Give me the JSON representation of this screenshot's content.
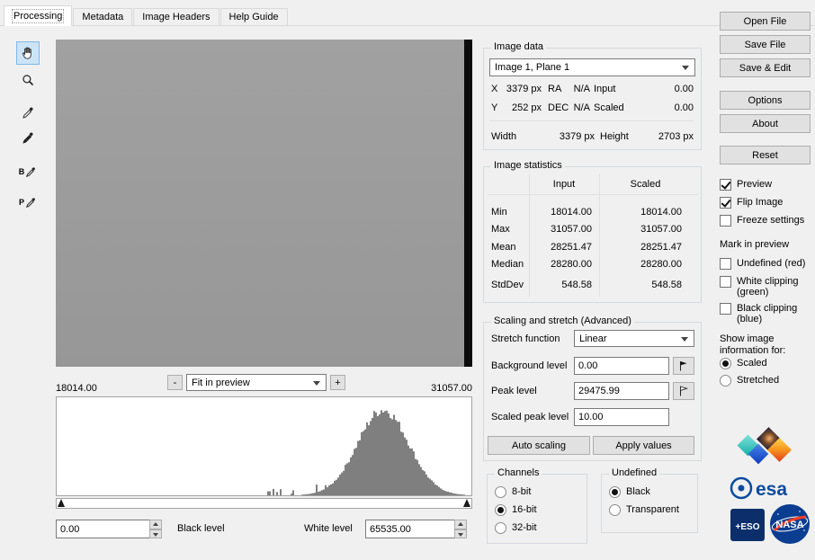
{
  "tabs": {
    "items": [
      {
        "label": "Processing",
        "active": true
      },
      {
        "label": "Metadata",
        "active": false
      },
      {
        "label": "Image Headers",
        "active": false
      },
      {
        "label": "Help Guide",
        "active": false
      }
    ]
  },
  "tools": {
    "selected": "hand",
    "b_label": "B",
    "p_label": "P"
  },
  "preview": {
    "min": "18014.00",
    "max": "31057.00",
    "zoom_out": "-",
    "zoom_in": "+",
    "zoom_mode": "Fit in preview"
  },
  "histogram": {
    "type": "histogram",
    "x_min": 18014.0,
    "x_max": 31057.0,
    "mean": 28251.47,
    "median": 28280.0,
    "stddev": 548.58,
    "center_fraction": 0.787,
    "sigma_fraction": 0.062,
    "bar_color": "#7f7f7f"
  },
  "levels": {
    "black_value": "0.00",
    "black_label": "Black level",
    "white_label": "White level",
    "white_value": "65535.00"
  },
  "image_data": {
    "title": "Image data",
    "plane": "Image 1, Plane 1",
    "x_label": "X",
    "x_value": "3379 px",
    "ra_label": "RA",
    "ra_value": "N/A",
    "input_label": "Input",
    "input_value": "0.00",
    "y_label": "Y",
    "y_value": "252 px",
    "dec_label": "DEC",
    "dec_value": "N/A",
    "scaled_label": "Scaled",
    "scaled_value": "0.00",
    "width_label": "Width",
    "width_value": "3379 px",
    "height_label": "Height",
    "height_value": "2703 px"
  },
  "image_statistics": {
    "title": "Image statistics",
    "col_input": "Input",
    "col_scaled": "Scaled",
    "rows": [
      {
        "label": "Min",
        "input": "18014.00",
        "scaled": "18014.00"
      },
      {
        "label": "Max",
        "input": "31057.00",
        "scaled": "31057.00"
      },
      {
        "label": "Mean",
        "input": "28251.47",
        "scaled": "28251.47"
      },
      {
        "label": "Median",
        "input": "28280.00",
        "scaled": "28280.00"
      },
      {
        "label": "StdDev",
        "input": "548.58",
        "scaled": "548.58"
      }
    ]
  },
  "scaling": {
    "title": "Scaling and stretch (Advanced)",
    "stretch_label": "Stretch function",
    "stretch_value": "Linear",
    "background_label": "Background level",
    "background_value": "0.00",
    "peak_label": "Peak level",
    "peak_value": "29475.99",
    "scaled_peak_label": "Scaled peak level",
    "scaled_peak_value": "10.00",
    "auto_scaling": "Auto scaling",
    "apply_values": "Apply values"
  },
  "channels": {
    "title": "Channels",
    "options": [
      {
        "label": "8-bit",
        "selected": false
      },
      {
        "label": "16-bit",
        "selected": true
      },
      {
        "label": "32-bit",
        "selected": false
      }
    ]
  },
  "undefined_group": {
    "title": "Undefined",
    "options": [
      {
        "label": "Black",
        "selected": true
      },
      {
        "label": "Transparent",
        "selected": false
      }
    ]
  },
  "side": {
    "open_file": "Open File",
    "save_file": "Save File",
    "save_edit": "Save & Edit",
    "options": "Options",
    "about": "About",
    "reset": "Reset",
    "checkboxes": [
      {
        "label": "Preview",
        "checked": true
      },
      {
        "label": "Flip Image",
        "checked": true
      },
      {
        "label": "Freeze settings",
        "checked": false
      }
    ],
    "mark_title": "Mark in preview",
    "mark_checkboxes": [
      {
        "label": "Undefined (red)",
        "checked": false
      },
      {
        "label": "White clipping (green)",
        "checked": false
      },
      {
        "label": "Black clipping (blue)",
        "checked": false
      }
    ],
    "show_title": "Show image information for:",
    "show_options": [
      {
        "label": "Scaled",
        "selected": true
      },
      {
        "label": "Stretched",
        "selected": false
      }
    ]
  },
  "logos": {
    "esa": "esa",
    "eso": "+ESO",
    "nasa": "NASA"
  }
}
